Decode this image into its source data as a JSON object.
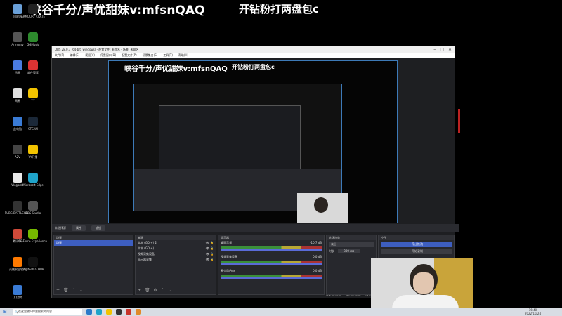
{
  "stream_overlay": {
    "line1": "峡谷千分/声优甜妹v:mfsnQAQ",
    "line2": "开钻粉打两盘包c"
  },
  "desktop_icons": [
    {
      "label": "回收站",
      "color": "#6aa0d8"
    },
    {
      "label": "ARMOURY CRATE",
      "color": "#222"
    },
    {
      "label": "Armoury",
      "color": "#555"
    },
    {
      "label": "GGMusic",
      "color": "#2d8a2d"
    },
    {
      "label": "迅雷",
      "color": "#4a7be0"
    },
    {
      "label": "软件管家",
      "color": "#d33"
    },
    {
      "label": "网易",
      "color": "#e0e0e0"
    },
    {
      "label": "YY",
      "color": "#f2c300"
    },
    {
      "label": "此电脑",
      "color": "#3a7bd5"
    },
    {
      "label": "STEAM",
      "color": "#1b2838"
    },
    {
      "label": "A2V",
      "color": "#444"
    },
    {
      "label": "YY开播",
      "color": "#f2c300"
    },
    {
      "label": "Wegame",
      "color": "#e8e8e8"
    },
    {
      "label": "Microsoft Edge",
      "color": "#1fa3c9"
    },
    {
      "label": "PUBG BATTLEGR...",
      "color": "#333"
    },
    {
      "label": "OBS Studio",
      "color": "#555"
    },
    {
      "label": "腾讯QQ",
      "color": "#d04a3a"
    },
    {
      "label": "GeForce Experience",
      "color": "#76b900"
    },
    {
      "label": "火绒安全软件",
      "color": "#ff7a00"
    },
    {
      "label": "Logitech G HUB",
      "color": "#111"
    },
    {
      "label": "QQ游戏",
      "color": "#3a7bd5"
    }
  ],
  "obs": {
    "title": "OBS 28.0.3 (64-bit, windows) - 配置文件: 未命名 - 场景: 未命名",
    "menu": [
      "文件(F)",
      "编辑(E)",
      "视图(V)",
      "停靠窗口(D)",
      "配置文件(P)",
      "场景集合(S)",
      "工具(T)",
      "帮助(H)"
    ],
    "scene_bar": {
      "label": "未选择源",
      "props": "属性",
      "filters": "滤镜"
    },
    "scenes": {
      "header": "场景",
      "items": [
        "场景"
      ]
    },
    "sources": {
      "header": "来源",
      "items": [
        "文本 (GDI+) 2",
        "文本 (GDI+)",
        "视频采集设备",
        "显示器采集"
      ]
    },
    "mixer": {
      "header": "混音器",
      "channels": [
        {
          "name": "桌面音频",
          "level": "-10.7 dB"
        },
        {
          "name": "视频采集设备",
          "level": "0.0 dB"
        },
        {
          "name": "麦克风/Aux",
          "level": "0.0 dB"
        }
      ]
    },
    "transitions": {
      "header": "转场特效",
      "type": "淡出",
      "duration_label": "时长",
      "duration": "300 ms"
    },
    "controls": {
      "header": "控件",
      "start_stream": "停止推流",
      "start_record": "开始录制"
    },
    "status": {
      "live": "LIVE: 00:00:00",
      "rec": "REC: 00:00:00",
      "cpu": "CPU: 5.4%, 60.00 fps"
    }
  },
  "taskbar": {
    "search_placeholder": "在这里输入你要搜索的内容",
    "time": "16:40",
    "date": "2022/10/24"
  }
}
